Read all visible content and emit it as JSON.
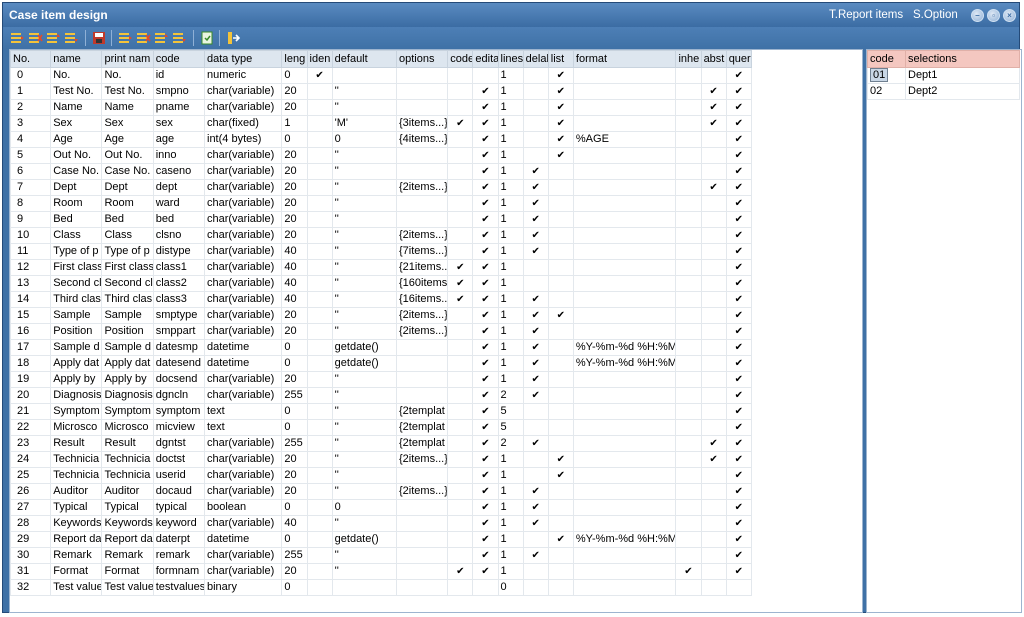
{
  "window": {
    "title": "Case item design",
    "menu_report": "T.Report items",
    "menu_option": "S.Option"
  },
  "icons": [
    "insert-row-icon",
    "delete-row-icon",
    "move-up-icon",
    "move-down-icon",
    "save-icon",
    "insert-row-icon",
    "delete-row-icon",
    "move-up-icon",
    "move-down-icon",
    "refresh-icon",
    "exit-icon"
  ],
  "grid": {
    "headers": [
      "No.",
      "name",
      "print nam",
      "code",
      "data type",
      "leng",
      "iden",
      "default",
      "options",
      "code",
      "edita",
      "lines",
      "delal",
      "list",
      "format",
      "inhe",
      "abst",
      "quer"
    ],
    "rows": [
      [
        "0",
        "No.",
        "No.",
        "id",
        "numeric",
        "0",
        "✔",
        "",
        "",
        "",
        "",
        "1",
        "",
        "✔",
        "",
        "",
        "",
        "✔"
      ],
      [
        "1",
        "Test No.",
        "Test No.",
        "smpno",
        "char(variable)",
        "20",
        "",
        "''",
        "",
        "",
        "✔",
        "1",
        "",
        "✔",
        "",
        "",
        "✔",
        "✔"
      ],
      [
        "2",
        "Name",
        "Name",
        "pname",
        "char(variable)",
        "20",
        "",
        "''",
        "",
        "",
        "✔",
        "1",
        "",
        "✔",
        "",
        "",
        "✔",
        "✔"
      ],
      [
        "3",
        "Sex",
        "Sex",
        "sex",
        "char(fixed)",
        "1",
        "",
        "'M'",
        "{3items...}",
        "✔",
        "✔",
        "1",
        "",
        "✔",
        "",
        "",
        "✔",
        "✔"
      ],
      [
        "4",
        "Age",
        "Age",
        "age",
        "int(4 bytes)",
        "0",
        "",
        "0",
        "{4items...}",
        "",
        "✔",
        "1",
        "",
        "✔",
        "%AGE",
        "",
        "",
        "✔"
      ],
      [
        "5",
        "Out No.",
        "Out No.",
        "inno",
        "char(variable)",
        "20",
        "",
        "''",
        "",
        "",
        "✔",
        "1",
        "",
        "✔",
        "",
        "",
        "",
        "✔"
      ],
      [
        "6",
        "Case No.",
        "Case No.",
        "caseno",
        "char(variable)",
        "20",
        "",
        "''",
        "",
        "",
        "✔",
        "1",
        "✔",
        "",
        "",
        "",
        "",
        "✔"
      ],
      [
        "7",
        "Dept",
        "Dept",
        "dept",
        "char(variable)",
        "20",
        "",
        "''",
        "{2items...}",
        "",
        "✔",
        "1",
        "✔",
        "",
        "",
        "",
        "✔",
        "✔"
      ],
      [
        "8",
        "Room",
        "Room",
        "ward",
        "char(variable)",
        "20",
        "",
        "''",
        "",
        "",
        "✔",
        "1",
        "✔",
        "",
        "",
        "",
        "",
        "✔"
      ],
      [
        "9",
        "Bed",
        "Bed",
        "bed",
        "char(variable)",
        "20",
        "",
        "''",
        "",
        "",
        "✔",
        "1",
        "✔",
        "",
        "",
        "",
        "",
        "✔"
      ],
      [
        "10",
        "Class",
        "Class",
        "clsno",
        "char(variable)",
        "20",
        "",
        "''",
        "{2items...}",
        "",
        "✔",
        "1",
        "✔",
        "",
        "",
        "",
        "",
        "✔"
      ],
      [
        "11",
        "Type of p",
        "Type of p",
        "distype",
        "char(variable)",
        "40",
        "",
        "''",
        "{7items...}",
        "",
        "✔",
        "1",
        "✔",
        "",
        "",
        "",
        "",
        "✔"
      ],
      [
        "12",
        "First class",
        "First class",
        "class1",
        "char(variable)",
        "40",
        "",
        "''",
        "{21items..",
        "✔",
        "✔",
        "1",
        "",
        "",
        "",
        "",
        "",
        "✔"
      ],
      [
        "13",
        "Second cl",
        "Second cl",
        "class2",
        "char(variable)",
        "40",
        "",
        "''",
        "{160items",
        "✔",
        "✔",
        "1",
        "",
        "",
        "",
        "",
        "",
        "✔"
      ],
      [
        "14",
        "Third clas",
        "Third clas",
        "class3",
        "char(variable)",
        "40",
        "",
        "''",
        "{16items..",
        "✔",
        "✔",
        "1",
        "✔",
        "",
        "",
        "",
        "",
        "✔"
      ],
      [
        "15",
        "Sample",
        "Sample",
        "smptype",
        "char(variable)",
        "20",
        "",
        "''",
        "{2items...}",
        "",
        "✔",
        "1",
        "✔",
        "✔",
        "",
        "",
        "",
        "✔"
      ],
      [
        "16",
        "Position",
        "Position",
        "smppart",
        "char(variable)",
        "20",
        "",
        "''",
        "{2items...}",
        "",
        "✔",
        "1",
        "✔",
        "",
        "",
        "",
        "",
        "✔"
      ],
      [
        "17",
        "Sample d",
        "Sample d",
        "datesmp",
        "datetime",
        "0",
        "",
        "getdate()",
        "",
        "",
        "✔",
        "1",
        "✔",
        "",
        "%Y-%m-%d %H:%M",
        "",
        "",
        "✔"
      ],
      [
        "18",
        "Apply dat",
        "Apply dat",
        "datesend",
        "datetime",
        "0",
        "",
        "getdate()",
        "",
        "",
        "✔",
        "1",
        "✔",
        "",
        "%Y-%m-%d %H:%M",
        "",
        "",
        "✔"
      ],
      [
        "19",
        "Apply by",
        "Apply by",
        "docsend",
        "char(variable)",
        "20",
        "",
        "''",
        "",
        "",
        "✔",
        "1",
        "✔",
        "",
        "",
        "",
        "",
        "✔"
      ],
      [
        "20",
        "Diagnosis",
        "Diagnosis",
        "dgncln",
        "char(variable)",
        "255",
        "",
        "''",
        "",
        "",
        "✔",
        "2",
        "✔",
        "",
        "",
        "",
        "",
        "✔"
      ],
      [
        "21",
        "Symptom",
        "Symptom",
        "symptom",
        "text",
        "0",
        "",
        "''",
        "{2templat",
        "",
        "✔",
        "5",
        "",
        "",
        "",
        "",
        "",
        "✔"
      ],
      [
        "22",
        "Microsco",
        "Microsco",
        "micview",
        "text",
        "0",
        "",
        "''",
        "{2templat",
        "",
        "✔",
        "5",
        "",
        "",
        "",
        "",
        "",
        "✔"
      ],
      [
        "23",
        "Result",
        "Result",
        "dgntst",
        "char(variable)",
        "255",
        "",
        "''",
        "{2templat",
        "",
        "✔",
        "2",
        "✔",
        "",
        "",
        "",
        "✔",
        "✔"
      ],
      [
        "24",
        "Technicia",
        "Technicia",
        "doctst",
        "char(variable)",
        "20",
        "",
        "''",
        "{2items...}",
        "",
        "✔",
        "1",
        "",
        "✔",
        "",
        "",
        "✔",
        "✔"
      ],
      [
        "25",
        "Technicia",
        "Technicia",
        "userid",
        "char(variable)",
        "20",
        "",
        "''",
        "",
        "",
        "✔",
        "1",
        "",
        "✔",
        "",
        "",
        "",
        "✔"
      ],
      [
        "26",
        "Auditor",
        "Auditor",
        "docaud",
        "char(variable)",
        "20",
        "",
        "''",
        "{2items...}",
        "",
        "✔",
        "1",
        "✔",
        "",
        "",
        "",
        "",
        "✔"
      ],
      [
        "27",
        "Typical",
        "Typical",
        "typical",
        "boolean",
        "0",
        "",
        "0",
        "",
        "",
        "✔",
        "1",
        "✔",
        "",
        "",
        "",
        "",
        "✔"
      ],
      [
        "28",
        "Keywords",
        "Keywords",
        "keyword",
        "char(variable)",
        "40",
        "",
        "''",
        "",
        "",
        "✔",
        "1",
        "✔",
        "",
        "",
        "",
        "",
        "✔"
      ],
      [
        "29",
        "Report da",
        "Report da",
        "daterpt",
        "datetime",
        "0",
        "",
        "getdate()",
        "",
        "",
        "✔",
        "1",
        "",
        "✔",
        "%Y-%m-%d %H:%M",
        "",
        "",
        "✔"
      ],
      [
        "30",
        "Remark",
        "Remark",
        "remark",
        "char(variable)",
        "255",
        "",
        "''",
        "",
        "",
        "✔",
        "1",
        "✔",
        "",
        "",
        "",
        "",
        "✔"
      ],
      [
        "31",
        "Format",
        "Format",
        "formnam",
        "char(variable)",
        "20",
        "",
        "''",
        "",
        "✔",
        "✔",
        "1",
        "",
        "",
        "",
        "✔",
        "",
        "✔"
      ],
      [
        "32",
        "Test value",
        "Test value",
        "testvalues",
        "binary",
        "0",
        "",
        "",
        "",
        "",
        "",
        "0",
        "",
        "",
        "",
        "",
        "",
        ""
      ]
    ]
  },
  "side": {
    "headers": [
      "code",
      "selections"
    ],
    "rows": [
      [
        "01",
        "Dept1"
      ],
      [
        "02",
        "Dept2"
      ]
    ]
  }
}
